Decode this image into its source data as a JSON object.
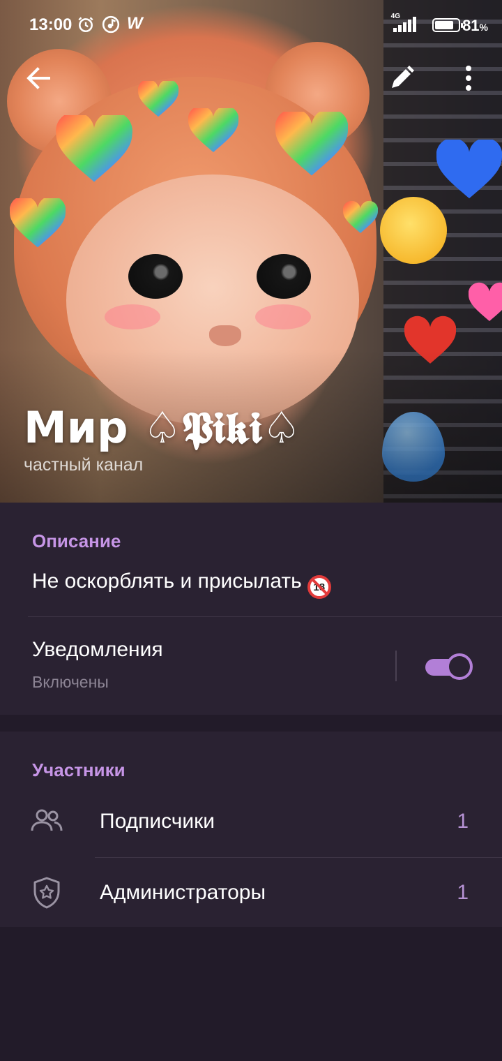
{
  "status_bar": {
    "time": "13:00",
    "network": "4G",
    "battery_percent": "81",
    "battery_suffix": "%",
    "icons": [
      "alarm-icon",
      "music-icon",
      "w-app-icon",
      "signal-icon",
      "battery-icon"
    ]
  },
  "toolbar": {
    "back_icon": "arrow-left-icon",
    "edit_icon": "pencil-icon",
    "more_icon": "more-vertical-icon"
  },
  "channel": {
    "title": "Мир ♤𝕻𝖎𝖐𝖎♤",
    "subtitle": "частный канал"
  },
  "info": {
    "description_label": "Описание",
    "description_text": "Не оскорблять и присылать",
    "description_emoji": "no-under-18-icon",
    "notifications_label": "Уведомления",
    "notifications_status": "Включены",
    "notifications_enabled": true
  },
  "members": {
    "section_label": "Участники",
    "rows": [
      {
        "label": "Подписчики",
        "count": "1",
        "icon": "people-icon"
      },
      {
        "label": "Администраторы",
        "count": "1",
        "icon": "shield-star-icon"
      }
    ]
  },
  "colors": {
    "background": "#2a2232",
    "accent": "#c695e6",
    "toggle_on": "#b27fd7",
    "count": "#b692d4",
    "section_gap": "#221b29"
  }
}
